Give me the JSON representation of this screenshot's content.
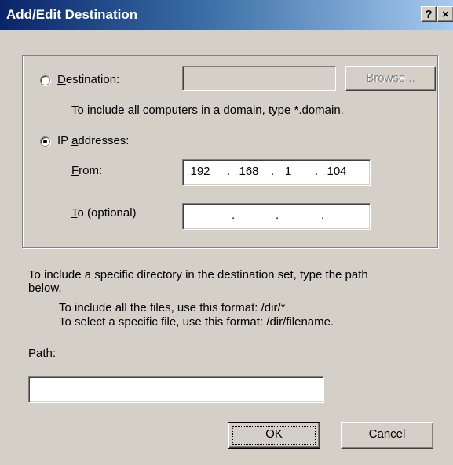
{
  "window": {
    "title": "Add/Edit Destination",
    "help_glyph": "?",
    "close_glyph": "×"
  },
  "destination_radio": {
    "label_underlined": "D",
    "label_rest": "estination:",
    "selected": false,
    "value": "",
    "browse_label": "Browse...",
    "hint": "To include all computers in a domain, type *.domain."
  },
  "ip_radio": {
    "label_prefix": "IP ",
    "label_underlined": "a",
    "label_rest": "ddresses:",
    "selected": true
  },
  "from": {
    "label_underlined": "F",
    "label_rest": "rom:",
    "octets": [
      "192",
      "168",
      "1",
      "104"
    ]
  },
  "to": {
    "label_underlined": "T",
    "label_rest": "o (optional)",
    "octets": [
      "",
      "",
      "",
      ""
    ]
  },
  "ip_separator": ".",
  "path_section": {
    "intro_line1": "To include a specific directory in the destination set, type the path",
    "intro_line2": "below.",
    "format_all": "To include all the files, use this format: /dir/*.",
    "format_file": "To select a specific file, use this format: /dir/filename.",
    "label_underlined": "P",
    "label_rest": "ath:",
    "value": ""
  },
  "buttons": {
    "ok": "OK",
    "cancel": "Cancel"
  }
}
